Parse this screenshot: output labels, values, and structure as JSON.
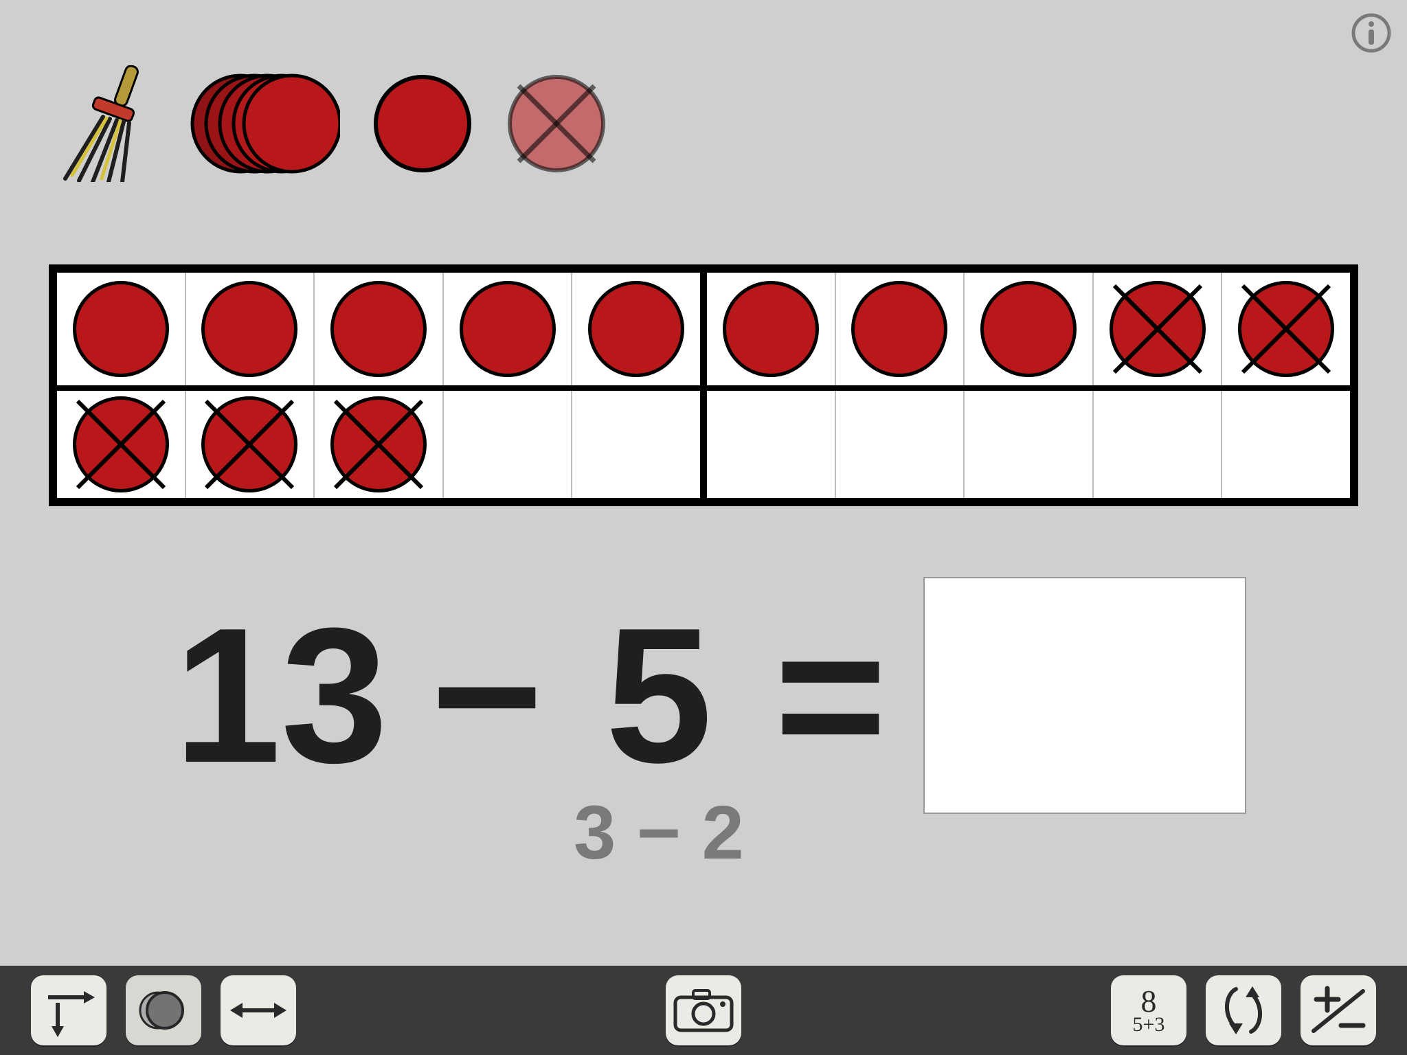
{
  "tools": {
    "broom": "broom-icon",
    "stack": "counter-stack-icon",
    "single": "counter-icon",
    "crossed": "crossed-counter-icon"
  },
  "frame": {
    "rows": [
      [
        "full",
        "full",
        "full",
        "full",
        "full",
        "full",
        "full",
        "full",
        "crossed",
        "crossed"
      ],
      [
        "crossed",
        "crossed",
        "crossed",
        "empty",
        "empty",
        "empty",
        "empty",
        "empty",
        "empty",
        "empty"
      ]
    ]
  },
  "equation": {
    "operand1": "13",
    "operator": "−",
    "operand2": "5",
    "equals": "=",
    "hint": "3 − 2",
    "answer": ""
  },
  "bottombar": {
    "orientation": "orientation-button",
    "shade": "shade-toggle-button",
    "flip": "flip-button",
    "camera": "camera-button",
    "numbers_top": "8",
    "numbers_bot": "5+3",
    "cycle": "cycle-button",
    "plusminus": "plus-minus-button"
  }
}
